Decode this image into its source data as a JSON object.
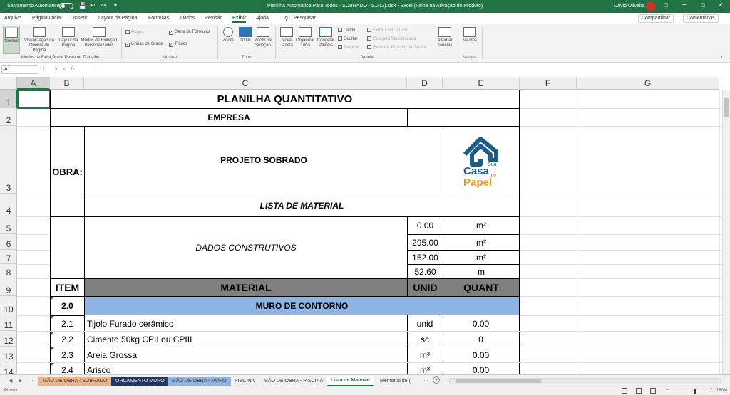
{
  "titlebar": {
    "autosave_label": "Salvamento Automático",
    "doc_title": "Planilha Automática Para Todos - SOBRADO - 5.0 (2).xlsx  -  Excel (Falha na Ativação do Produto)",
    "user": "David Oliveira",
    "colors": {
      "excel_green": "#217346"
    }
  },
  "menu_tabs": [
    "Arquivo",
    "Página Inicial",
    "Inserir",
    "Layout da Página",
    "Fórmulas",
    "Dados",
    "Revisão",
    "Exibir",
    "Ajuda"
  ],
  "active_tab": "Exibir",
  "search_label": "Pesquisar",
  "share_label": "Compartilhar",
  "comments_label": "Comentários",
  "ribbon": {
    "normal": "Normal",
    "page_break": "Visualização da Quebra de Página",
    "page_layout": "Layout da Página",
    "custom_views": "Modos de Exibição Personalizados",
    "group_views": "Modos de Exibição de Pasta de Trabalho",
    "ruler": "Régua",
    "formula_bar": "Barra de Fórmulas",
    "gridlines": "Linhas de Grade",
    "headings": "Títulos",
    "group_show": "Mostrar",
    "zoom": "Zoom",
    "zoom100": "100%",
    "zoom_selection": "Zoom na Seleção",
    "group_zoom": "Zoom",
    "new_window": "Nova Janela",
    "arrange_all": "Organizar Tudo",
    "freeze_panes": "Congelar Painéis",
    "split": "Dividir",
    "hide": "Ocultar",
    "unhide": "Reexibir",
    "view_side": "Exibir Lado a Lado",
    "sync_scroll": "Rolagem Sincronizada",
    "reset_pos": "Redefinir Posição da Janela",
    "switch_windows": "Alternar Janelas",
    "group_window": "Janela",
    "macros": "Macros",
    "group_macros": "Macros"
  },
  "formula_bar": {
    "name_box": "A1",
    "fx": "fx",
    "value": ""
  },
  "columns": [
    "A",
    "B",
    "C",
    "D",
    "E",
    "F",
    "G"
  ],
  "rows": [
    "1",
    "2",
    "3",
    "4",
    "5",
    "6",
    "7",
    "8",
    "9",
    "10",
    "11",
    "12",
    "13",
    "14"
  ],
  "sheet": {
    "title": "PLANILHA QUANTITATIVO",
    "empresa": "EMPRESA",
    "obra_label": "OBRA:",
    "projeto": "PROJETO SOBRADO",
    "lista": "LISTA DE MATERIAL",
    "dados": "DADOS CONSTRUTIVOS",
    "logo": {
      "sua": "Sua",
      "casa": "Casa",
      "no": "no",
      "papel": "Papel",
      "blue": "#1b5e8c",
      "orange": "#f29a1f"
    },
    "dados_rows": [
      {
        "value": "0.00",
        "unit": "m²"
      },
      {
        "value": "295.00",
        "unit": "m²"
      },
      {
        "value": "152.00",
        "unit": "m²"
      },
      {
        "value": "52.60",
        "unit": "m"
      }
    ],
    "header": {
      "item": "ITEM",
      "material": "MATERIAL",
      "unid": "UNID",
      "quant": "QUANT"
    },
    "section": {
      "item": "2.0",
      "title": "MURO DE CONTORNO"
    },
    "items": [
      {
        "item": "2.1",
        "material": "Tijolo Furado cerâmico",
        "unid": "unid",
        "quant": "0.00"
      },
      {
        "item": "2.2",
        "material": "Cimento 50kg CPII ou CPIII",
        "unid": "sc",
        "quant": "0"
      },
      {
        "item": "2.3",
        "material": "Areia Grossa",
        "unid": "m³",
        "quant": "0.00"
      },
      {
        "item": "2.4",
        "material": "Arisco",
        "unid": "m³",
        "quant": "0.00"
      }
    ],
    "colors": {
      "header_grey": "#808080",
      "section_blue": "#8db4e2"
    }
  },
  "sheet_tabs": [
    {
      "label": "MÃO DE OBRA - SOBRADO",
      "color": "#f4b183"
    },
    {
      "label": "ORÇAMENTO MURO",
      "color": "#1f3864"
    },
    {
      "label": "MÃO DE OBRA - MURO",
      "color": "#8db4e2"
    },
    {
      "label": "PISCINA",
      "color": ""
    },
    {
      "label": "MÃO DE OBRA - PISCINA",
      "color": ""
    },
    {
      "label": "Lista de Material",
      "color": "active"
    },
    {
      "label": "Memorial de (",
      "color": ""
    }
  ],
  "status": {
    "ready": "Pronto",
    "zoom": "180%"
  }
}
